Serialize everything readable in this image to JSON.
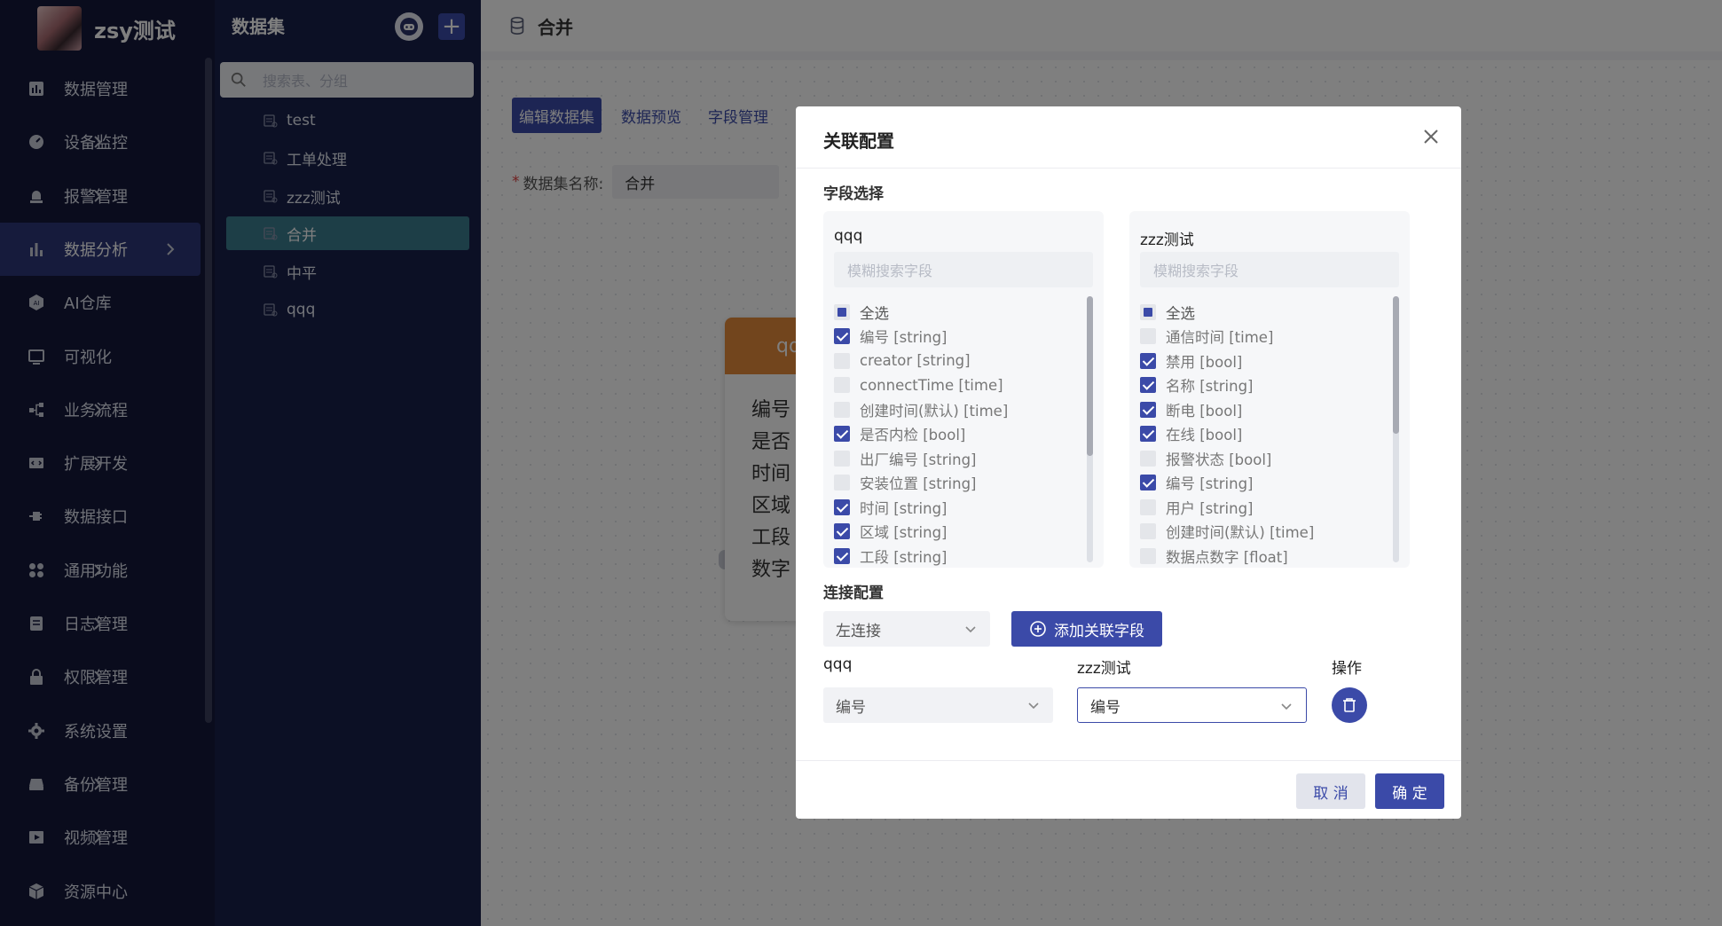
{
  "nav": {
    "brand_name": "zsy测试",
    "items": [
      {
        "label": "数据管理",
        "icon": "bar-chart-icon",
        "arrow": false,
        "active": false
      },
      {
        "label": "设备监控",
        "icon": "gauge-icon",
        "arrow": true,
        "active": false
      },
      {
        "label": "报警管理",
        "icon": "alarm-light-icon",
        "arrow": true,
        "active": false
      },
      {
        "label": "数据分析",
        "icon": "analysis-bars-icon",
        "arrow": true,
        "active": true
      },
      {
        "label": "AI仓库",
        "icon": "ai-hexagon-icon",
        "arrow": false,
        "active": false
      },
      {
        "label": "可视化",
        "icon": "monitor-icon",
        "arrow": false,
        "active": false
      },
      {
        "label": "业务流程",
        "icon": "flow-icon",
        "arrow": true,
        "active": false
      },
      {
        "label": "扩展开发",
        "icon": "code-window-icon",
        "arrow": true,
        "active": false
      },
      {
        "label": "数据接口",
        "icon": "plug-icon",
        "arrow": false,
        "active": false
      },
      {
        "label": "通用功能",
        "icon": "grid-dots-icon",
        "arrow": true,
        "active": false
      },
      {
        "label": "日志管理",
        "icon": "log-file-icon",
        "arrow": true,
        "active": false
      },
      {
        "label": "权限管理",
        "icon": "lock-icon",
        "arrow": true,
        "active": false
      },
      {
        "label": "系统设置",
        "icon": "gear-icon",
        "arrow": false,
        "active": false
      },
      {
        "label": "备份管理",
        "icon": "hard-drive-icon",
        "arrow": true,
        "active": false
      },
      {
        "label": "视频管理",
        "icon": "video-icon",
        "arrow": true,
        "active": false
      },
      {
        "label": "资源中心",
        "icon": "cube-icon",
        "arrow": false,
        "active": false
      }
    ]
  },
  "dataset_panel": {
    "title": "数据集",
    "search_placeholder": "搜索表、分组",
    "items": [
      {
        "label": "test",
        "active": false
      },
      {
        "label": "工单处理",
        "active": false
      },
      {
        "label": "zzz测试",
        "active": false
      },
      {
        "label": "合并",
        "active": true
      },
      {
        "label": "中平",
        "active": false
      },
      {
        "label": "qqq",
        "active": false
      }
    ]
  },
  "main": {
    "title": "合并",
    "tabs": [
      "编辑数据集",
      "数据预览",
      "字段管理"
    ],
    "name_label": "数据集名称:",
    "name_required_mark": "*",
    "name_value": "合并",
    "node": {
      "header": "qq",
      "fields": [
        "编号",
        "是否",
        "时间",
        "区域",
        "工段",
        "数字"
      ]
    }
  },
  "modal": {
    "title": "关联配置",
    "field_section": "字段选择",
    "left_table": {
      "name": "qqq",
      "search_placeholder": "模糊搜索字段",
      "select_all": "全选",
      "fields": [
        {
          "label": "编号 [string]",
          "checked": true
        },
        {
          "label": "creator [string]",
          "checked": false
        },
        {
          "label": "connectTime [time]",
          "checked": false
        },
        {
          "label": "创建时间(默认) [time]",
          "checked": false
        },
        {
          "label": "是否内检 [bool]",
          "checked": true
        },
        {
          "label": "出厂编号 [string]",
          "checked": false
        },
        {
          "label": "安装位置 [string]",
          "checked": false
        },
        {
          "label": "时间 [string]",
          "checked": true
        },
        {
          "label": "区域 [string]",
          "checked": true
        },
        {
          "label": "工段 [string]",
          "checked": true
        }
      ]
    },
    "right_table": {
      "name": "zzz测试",
      "search_placeholder": "模糊搜索字段",
      "select_all": "全选",
      "fields": [
        {
          "label": "通信时间 [time]",
          "checked": false
        },
        {
          "label": "禁用 [bool]",
          "checked": true
        },
        {
          "label": "名称 [string]",
          "checked": true
        },
        {
          "label": "断电 [bool]",
          "checked": true
        },
        {
          "label": "在线 [bool]",
          "checked": true
        },
        {
          "label": "报警状态 [bool]",
          "checked": false
        },
        {
          "label": "编号 [string]",
          "checked": true
        },
        {
          "label": "用户 [string]",
          "checked": false
        },
        {
          "label": "创建时间(默认) [time]",
          "checked": false
        },
        {
          "label": "数据点数字 [float]",
          "checked": false
        }
      ]
    },
    "join_section": "连接配置",
    "join_type": "左连接",
    "add_field_button": "添加关联字段",
    "left_col_label": "qqq",
    "right_col_label": "zzz测试",
    "action_col_label": "操作",
    "left_field_value": "编号",
    "right_field_value": "编号",
    "cancel_button": "取 消",
    "confirm_button": "确 定"
  },
  "colors": {
    "primary": "#3b4aa8",
    "nav_bg": "#14193a",
    "panel_bg": "#18204a",
    "active_dataset": "#3a7c8f",
    "node_header": "#e58a3b"
  }
}
